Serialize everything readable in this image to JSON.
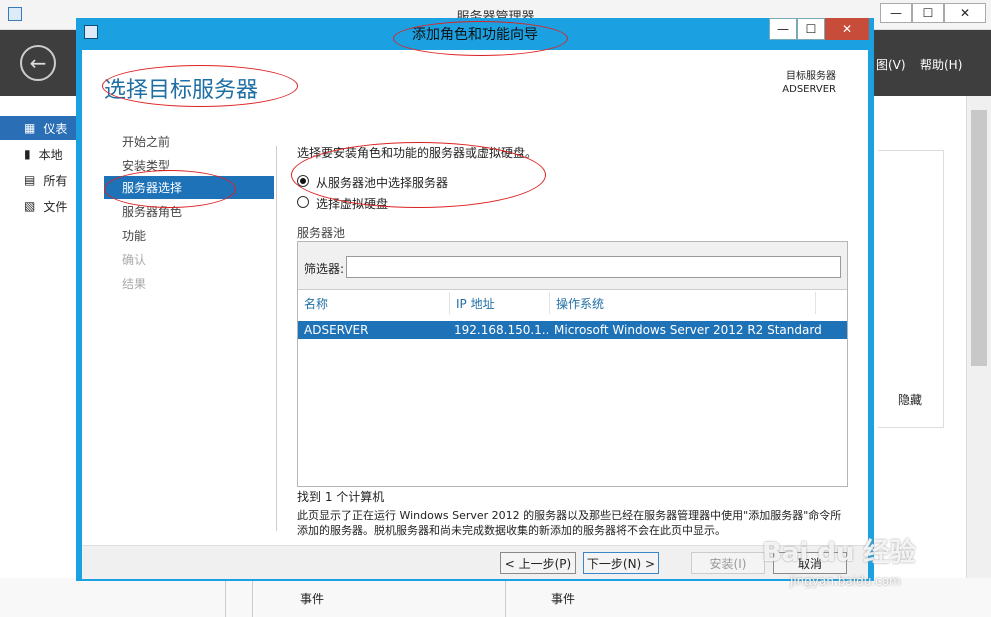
{
  "bg": {
    "title": "服务器管理器",
    "menu": [
      "图(V)",
      "帮助(H)"
    ],
    "sidebar": [
      "仪表",
      "本地",
      "所有",
      "文件"
    ],
    "hide_label": "隐藏",
    "events": [
      "事件",
      "事件"
    ],
    "window_buttons": [
      "—",
      "☐",
      "✕"
    ]
  },
  "wizard": {
    "title": "添加角色和功能向导",
    "window_buttons": [
      "—",
      "☐",
      "✕"
    ],
    "heading": "选择目标服务器",
    "dest_label": "目标服务器",
    "dest_value": "ADSERVER",
    "nav": [
      {
        "label": "开始之前",
        "state": "normal"
      },
      {
        "label": "安装类型",
        "state": "normal"
      },
      {
        "label": "服务器选择",
        "state": "active"
      },
      {
        "label": "服务器角色",
        "state": "normal"
      },
      {
        "label": "功能",
        "state": "normal"
      },
      {
        "label": "确认",
        "state": "disabled"
      },
      {
        "label": "结果",
        "state": "disabled"
      }
    ],
    "instruction": "选择要安装角色和功能的服务器或虚拟硬盘。",
    "options": [
      {
        "label": "从服务器池中选择服务器",
        "selected": true
      },
      {
        "label": "选择虚拟硬盘",
        "selected": false
      }
    ],
    "pool_label": "服务器池",
    "filter_label": "筛选器:",
    "filter_value": "",
    "columns": [
      "名称",
      "IP 地址",
      "操作系统"
    ],
    "rows": [
      {
        "name": "ADSERVER",
        "ip": "192.168.150.1...",
        "os": "Microsoft Windows Server 2012 R2 Standard"
      }
    ],
    "found": "找到 1 个计算机",
    "description": "此页显示了正在运行 Windows Server 2012 的服务器以及那些已经在服务器管理器中使用\"添加服务器\"命令所添加的服务器。脱机服务器和尚未完成数据收集的新添加的服务器将不会在此页中显示。",
    "buttons": {
      "prev": "< 上一步(P)",
      "next": "下一步(N) >",
      "install": "安装(I)",
      "cancel": "取消"
    }
  },
  "watermark": {
    "brand": "Bai du 经验",
    "url": "jingyan.baidu.com"
  },
  "colors": {
    "accent": "#1ba1e2",
    "selection": "#1e72b8",
    "heading": "#1f6fa5",
    "annotation": "#d22222"
  }
}
